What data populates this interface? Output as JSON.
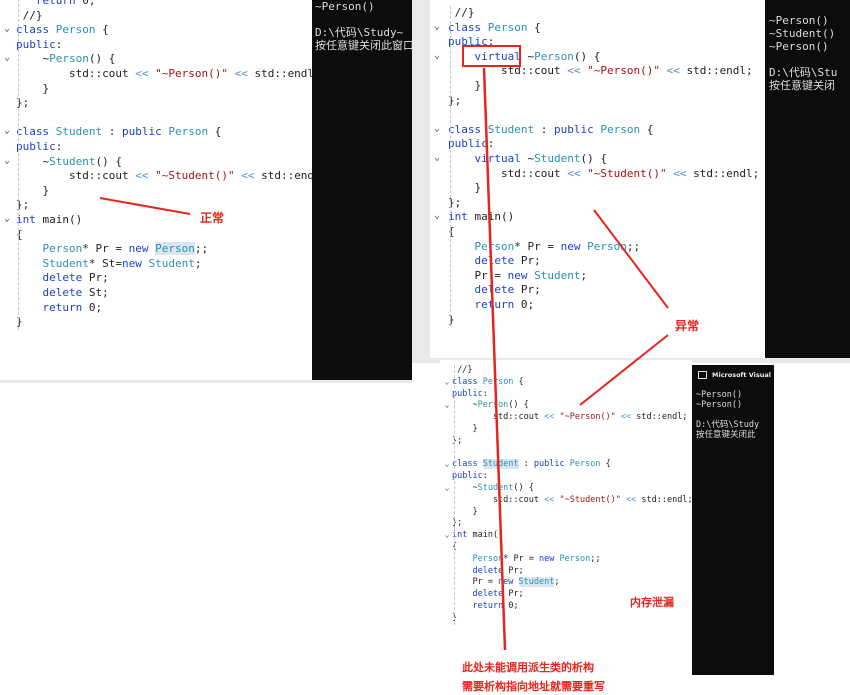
{
  "panel1": {
    "lines": [
      "   return 0;",
      " //}",
      "class Person {",
      "public:",
      "    ~Person() {",
      "        std::cout << \"~Person()\" << std::endl;",
      "    }",
      "};",
      "",
      "class Student : public Person {",
      "public:",
      "    ~Student() {",
      "        std::cout << \"~Student()\" << std::endl;",
      "    }",
      "};",
      "int main()",
      "{",
      "    Person* Pr = new Person;;",
      "    Student* St=new Student;",
      "    delete Pr;",
      "    delete St;",
      "    return 0;",
      "}"
    ]
  },
  "console1": {
    "lines": [
      "~Person()",
      "",
      "D:\\代码\\Study~",
      "按任意键关闭此窗口"
    ]
  },
  "panel2": {
    "lines": [
      " //}",
      "class Person {",
      "public:",
      "    virtual ~Person() {",
      "        std::cout << \"~Person()\" << std::endl;",
      "    }",
      "};",
      "",
      "class Student : public Person {",
      "public:",
      "    virtual ~Student() {",
      "        std::cout << \"~Student()\" << std::endl;",
      "    }",
      "};",
      "int main()",
      "{",
      "    Person* Pr = new Person;;",
      "    delete Pr;",
      "    Pr = new Student;",
      "    delete Pr;",
      "    return 0;",
      "}"
    ]
  },
  "console2": {
    "lines": [
      "~Person()",
      "~Student()",
      "~Person()",
      "",
      "D:\\代码\\Stu",
      "按任意键关闭"
    ]
  },
  "panel3": {
    "lines": [
      " //}",
      "class Person {",
      "public:",
      "    ~Person() {",
      "        std::cout << \"~Person()\" << std::endl;",
      "    }",
      "};",
      "",
      "class Student : public Person {",
      "public:",
      "    ~Student() {",
      "        std::cout << \"~Student()\" << std::endl;",
      "    }",
      "};",
      "int main()",
      "{",
      "    Person* Pr = new Person;;",
      "    delete Pr;",
      "    Pr = new Student;",
      "    delete Pr;",
      "    return 0;",
      "}"
    ]
  },
  "console3": {
    "title": "Microsoft Visual",
    "lines": [
      "~Person()",
      "~Person()",
      "",
      "D:\\代码\\Study",
      "按任意键关闭此"
    ]
  },
  "annotations": {
    "normal": "正常",
    "abnormal": "异常",
    "leak": "内存泄漏",
    "note_line1": "此处未能调用派生类的析构",
    "note_line2": "需要析构指向地址就需要重写"
  },
  "colors": {
    "annotation_red": "#e8241e",
    "console_bg": "#0c0c0c"
  }
}
